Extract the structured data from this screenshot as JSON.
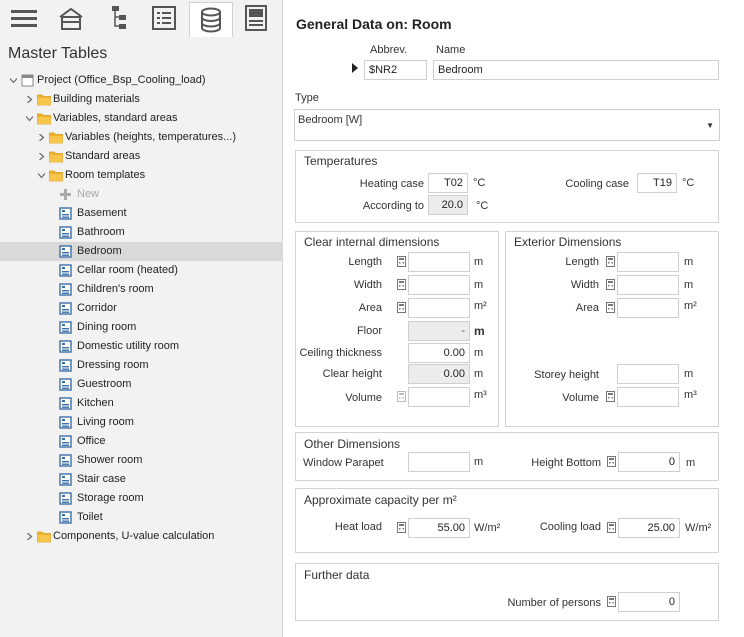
{
  "toolbar": {
    "items": [
      {
        "icon": "menu-icon"
      },
      {
        "icon": "building-icon"
      },
      {
        "icon": "hierarchy-icon"
      },
      {
        "icon": "list-icon"
      },
      {
        "icon": "database-icon",
        "active": true
      },
      {
        "icon": "settings-panel-icon"
      }
    ]
  },
  "sidebar": {
    "title": "Master Tables",
    "tree": [
      {
        "label": "Project (Office_Bsp_Cooling_load)",
        "level": 0,
        "icon": "project-icon",
        "expanded": true
      },
      {
        "label": "Building materials",
        "level": 1,
        "icon": "folder-icon",
        "expanded": false
      },
      {
        "label": "Variables, standard areas",
        "level": 1,
        "icon": "folder-icon",
        "expanded": true
      },
      {
        "label": "Variables (heights, temperatures...)",
        "level": 2,
        "icon": "folder-icon",
        "expanded": false
      },
      {
        "label": "Standard areas",
        "level": 2,
        "icon": "folder-icon",
        "expanded": false
      },
      {
        "label": "Room templates",
        "level": 2,
        "icon": "folder-icon",
        "expanded": true
      },
      {
        "label": "New",
        "level": 3,
        "icon": "plus-icon",
        "disabled": true
      },
      {
        "label": "Basement",
        "level": 3,
        "icon": "room-icon"
      },
      {
        "label": "Bathroom",
        "level": 3,
        "icon": "room-icon"
      },
      {
        "label": "Bedroom",
        "level": 3,
        "icon": "room-icon",
        "selected": true
      },
      {
        "label": "Cellar room (heated)",
        "level": 3,
        "icon": "room-icon"
      },
      {
        "label": "Children's room",
        "level": 3,
        "icon": "room-icon"
      },
      {
        "label": "Corridor",
        "level": 3,
        "icon": "room-icon"
      },
      {
        "label": "Dining room",
        "level": 3,
        "icon": "room-icon"
      },
      {
        "label": "Domestic utility room",
        "level": 3,
        "icon": "room-icon"
      },
      {
        "label": "Dressing room",
        "level": 3,
        "icon": "room-icon"
      },
      {
        "label": "Guestroom",
        "level": 3,
        "icon": "room-icon"
      },
      {
        "label": "Kitchen",
        "level": 3,
        "icon": "room-icon"
      },
      {
        "label": "Living room",
        "level": 3,
        "icon": "room-icon"
      },
      {
        "label": "Office",
        "level": 3,
        "icon": "room-icon"
      },
      {
        "label": "Shower room",
        "level": 3,
        "icon": "room-icon"
      },
      {
        "label": "Stair case",
        "level": 3,
        "icon": "room-icon"
      },
      {
        "label": "Storage room",
        "level": 3,
        "icon": "room-icon"
      },
      {
        "label": "Toilet",
        "level": 3,
        "icon": "room-icon"
      },
      {
        "label": "Components, U-value calculation",
        "level": 1,
        "icon": "folder-icon",
        "expanded": false
      }
    ]
  },
  "main": {
    "title": "General Data on: Room",
    "abbrev_label": "Abbrev.",
    "name_label": "Name",
    "abbrev_value": "$NR2",
    "name_value": "Bedroom",
    "type_label": "Type",
    "type_value": "Bedroom [W]",
    "temperatures": {
      "title": "Temperatures",
      "heating_case_label": "Heating case",
      "heating_case_value": "T02",
      "heating_case_unit": "°C",
      "cooling_case_label": "Cooling case",
      "cooling_case_value": "T19",
      "cooling_case_unit": "°C",
      "according_to_label": "According to",
      "according_to_value": "20.0",
      "according_to_unit": "°C"
    },
    "clear_internal": {
      "title": "Clear internal dimensions",
      "length_label": "Length",
      "length_unit": "m",
      "length_value": "",
      "width_label": "Width",
      "width_unit": "m",
      "width_value": "",
      "area_label": "Area",
      "area_unit": "m²",
      "area_value": "",
      "floor_label": "Floor",
      "floor_value": "-",
      "floor_unit": "m",
      "ceiling_label": "Ceiling thickness",
      "ceiling_value": "0.00",
      "ceiling_unit": "m",
      "clear_height_label": "Clear height",
      "clear_height_value": "0.00",
      "clear_height_unit": "m",
      "volume_label": "Volume",
      "volume_unit": "m³",
      "volume_value": ""
    },
    "exterior": {
      "title": "Exterior Dimensions",
      "length_label": "Length",
      "length_unit": "m",
      "length_value": "",
      "width_label": "Width",
      "width_unit": "m",
      "width_value": "",
      "area_label": "Area",
      "area_unit": "m²",
      "area_value": "",
      "storey_label": "Storey height",
      "storey_unit": "m",
      "storey_value": "",
      "volume_label": "Volume",
      "volume_unit": "m³",
      "volume_value": ""
    },
    "other": {
      "title": "Other Dimensions",
      "parapet_label": "Window Parapet",
      "parapet_value": "",
      "parapet_unit": "m",
      "height_bottom_label": "Height Bottom",
      "height_bottom_value": "0",
      "height_bottom_unit": "m"
    },
    "capacity": {
      "title": "Approximate capacity per m²",
      "heat_label": "Heat load",
      "heat_value": "55.00",
      "heat_unit": "W/m²",
      "cool_label": "Cooling load",
      "cool_value": "25.00",
      "cool_unit": "W/m²"
    },
    "further": {
      "title": "Further data",
      "persons_label": "Number of persons",
      "persons_value": "0"
    }
  }
}
